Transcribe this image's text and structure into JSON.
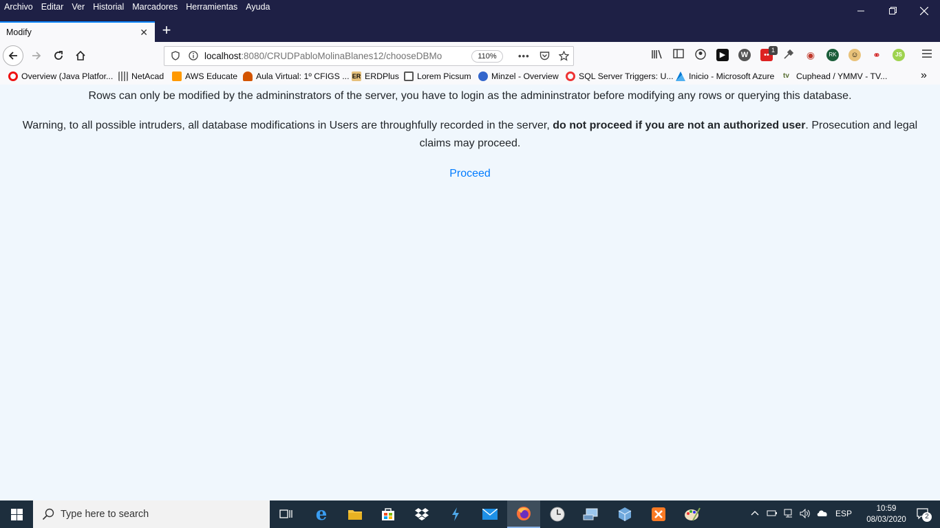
{
  "menubar": {
    "items": [
      "Archivo",
      "Editar",
      "Ver",
      "Historial",
      "Marcadores",
      "Herramientas",
      "Ayuda"
    ]
  },
  "tab": {
    "title": "Modify"
  },
  "url": {
    "host": "localhost",
    "rest": ":8080/CRUDPabloMolinaBlanes12/chooseDBMo",
    "zoom": "110%"
  },
  "bookmarks": [
    {
      "label": "Overview (Java Platfor...",
      "color": "#e11"
    },
    {
      "label": "NetAcad",
      "color": "#777"
    },
    {
      "label": "AWS Educate",
      "color": "#f90"
    },
    {
      "label": "Aula Virtual: 1º CFIGS ...",
      "color": "#d35400"
    },
    {
      "label": "ERDPlus",
      "color": "#e5c07b"
    },
    {
      "label": "Lorem Picsum",
      "color": "#555"
    },
    {
      "label": "Minzel - Overview",
      "color": "#3366cc"
    },
    {
      "label": "SQL Server Triggers: U...",
      "color": "#e33"
    },
    {
      "label": "Inicio - Microsoft Azure",
      "color": "#0078d4"
    },
    {
      "label": "Cuphead / YMMV - TV...",
      "color": "#556b2f"
    }
  ],
  "content": {
    "line1": "Rows can only be modified by the admininstrators of the server, you have to login as the admininstrator before modifying any rows or querying this database.",
    "warning_pre": "Warning, to all possible intruders, all database modifications in Users are throughfully recorded in the server, ",
    "warning_bold": "do not proceed if you are not an authorized user",
    "warning_post": ". Prosecution and legal claims may proceed.",
    "proceed_link": "Proceed"
  },
  "taskbar": {
    "search_placeholder": "Type here to search",
    "language": "ESP",
    "time": "10:59",
    "date": "08/03/2020",
    "notification_count": "2"
  },
  "extension_badge": "1"
}
